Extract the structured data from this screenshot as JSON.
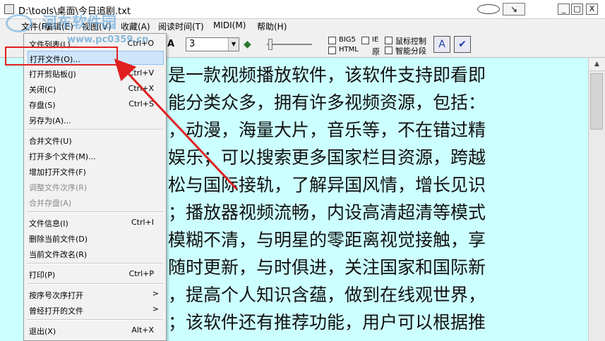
{
  "window": {
    "title": "D:\\tools\\桌面\\今日追剧.txt",
    "oval_label": "",
    "arrow_button": "↘",
    "minimize": "_",
    "maximize": "□",
    "close": "X"
  },
  "menubar": {
    "items": [
      "文件(F)",
      "编辑(E)",
      "视图(V)",
      "收藏(A)",
      "阅读时间(T)",
      "MIDI(M)",
      "帮助(H)"
    ]
  },
  "toolbar": {
    "font_size_value": "3",
    "checkboxes": {
      "big5": "BIG5",
      "ie": "IE",
      "mouse_control": "鼠标控制",
      "html": "HTML",
      "original": "原",
      "smart_segment": "智能分段"
    }
  },
  "file_menu": {
    "items": [
      {
        "label": "文件列表(L)...",
        "shortcut": "Ctrl+O",
        "enabled": true
      },
      {
        "label": "打开文件(O)...",
        "shortcut": "",
        "enabled": true,
        "highlighted": true
      },
      {
        "label": "打开剪贴板(J)",
        "shortcut": "Ctrl+V",
        "enabled": true
      },
      {
        "label": "关闭(C)",
        "shortcut": "Ctrl+X",
        "enabled": true
      },
      {
        "label": "存盘(S)",
        "shortcut": "Ctrl+S",
        "enabled": true
      },
      {
        "label": "另存为(A)...",
        "shortcut": "",
        "enabled": true
      },
      {
        "label": "合并文件(U)",
        "shortcut": "",
        "enabled": true
      },
      {
        "label": "打开多个文件(M)...",
        "shortcut": "",
        "enabled": true
      },
      {
        "label": "增加打开文件(F)",
        "shortcut": "",
        "enabled": true
      },
      {
        "label": "调整文件次序(R)",
        "shortcut": "",
        "enabled": false
      },
      {
        "label": "合并存盘(A)",
        "shortcut": "",
        "enabled": false
      },
      {
        "label": "文件信息(I)",
        "shortcut": "Ctrl+I",
        "enabled": true
      },
      {
        "label": "删除当前文件(D)",
        "shortcut": "",
        "enabled": true
      },
      {
        "label": "当前文件改名(R)",
        "shortcut": "",
        "enabled": true
      },
      {
        "label": "打印(P)",
        "shortcut": "Ctrl+P",
        "enabled": true
      },
      {
        "label": "按序号次序打开",
        "shortcut": "",
        "submenu": ">",
        "enabled": true
      },
      {
        "label": "曾经打开的文件",
        "shortcut": "",
        "submenu": ">",
        "enabled": true
      },
      {
        "label": "退出(X)",
        "shortcut": "Alt+X",
        "enabled": true
      }
    ]
  },
  "content": {
    "lines": [
      "是一款视频播放软件，该软件支持即看即",
      "能分类众多，拥有许多视频资源，包括：",
      "，动漫，海量大片，音乐等，不在错过精",
      "娱乐；可以搜索更多国家栏目资源，跨越",
      "松与国际接轨，了解异国风情，增长见识",
      "；播放器视频流畅，内设高清超清等模式",
      "模糊不清，与明星的零距离视觉接触，享",
      "随时更新，与时俱进，关注国家和国际新",
      "，提高个人知识含蕴，做到在线观世界，",
      "；该软件还有推荐功能，用户可以根据推"
    ],
    "background_color": "#ccffff"
  },
  "watermark": {
    "title": "河东软件园",
    "url": "www.pc0359.cn"
  },
  "annotation": {
    "arrow_color": "#e02020",
    "box_color": "#e02020"
  }
}
